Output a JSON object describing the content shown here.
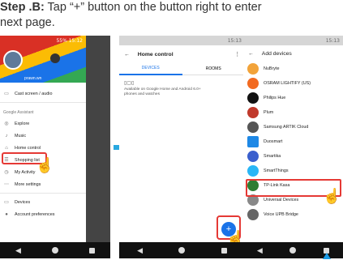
{
  "caption": {
    "step": "Step .B:",
    "text": " Tap “+” button on the button right to enter",
    "line2": "next page."
  },
  "phone1": {
    "status_time": "55% 15:12",
    "account": "prawn.wn",
    "items": [
      {
        "icon": "▭",
        "label": "Cast screen / audio"
      },
      {
        "icon": "◎",
        "label": "Explore"
      },
      {
        "icon": "♪",
        "label": "Music"
      },
      {
        "icon": "⌂",
        "label": "Home control"
      },
      {
        "icon": "☰",
        "label": "Shopping list"
      },
      {
        "icon": "◷",
        "label": "My Activity"
      },
      {
        "icon": "⋯",
        "label": "More settings"
      },
      {
        "icon": "▭",
        "label": "Devices"
      },
      {
        "icon": "●",
        "label": "Account preferences"
      }
    ],
    "section": "Google Assistant"
  },
  "phone2": {
    "status_time": "15:13",
    "title": "Home control",
    "tabs": [
      "DEVICES",
      "ROOMS"
    ],
    "desc": "Available on Google Home and Android 6.0+ phones and watches",
    "fab": "+"
  },
  "phone3": {
    "status_time": "15:13",
    "title": "Add devices",
    "devices": [
      {
        "name": "NuBryte",
        "color": "#f2a33a"
      },
      {
        "name": "OSRAM LIGHTIFY (US)",
        "color": "#f26a21"
      },
      {
        "name": "Philips Hue",
        "color": "#111111"
      },
      {
        "name": "Plum",
        "color": "#c0392b"
      },
      {
        "name": "Samsung ARTIK Cloud",
        "color": "#555555"
      },
      {
        "name": "Duosmart",
        "color": "#1e88e5"
      },
      {
        "name": "Smartika",
        "color": "#3a5fcd"
      },
      {
        "name": "SmartThings",
        "color": "#29b6f6"
      },
      {
        "name": "TP-Link Kasa",
        "color": "#2e7d32"
      },
      {
        "name": "Universal Devices",
        "color": "#888888"
      },
      {
        "name": "Voice UPB Bridge",
        "color": "#666666"
      }
    ]
  }
}
